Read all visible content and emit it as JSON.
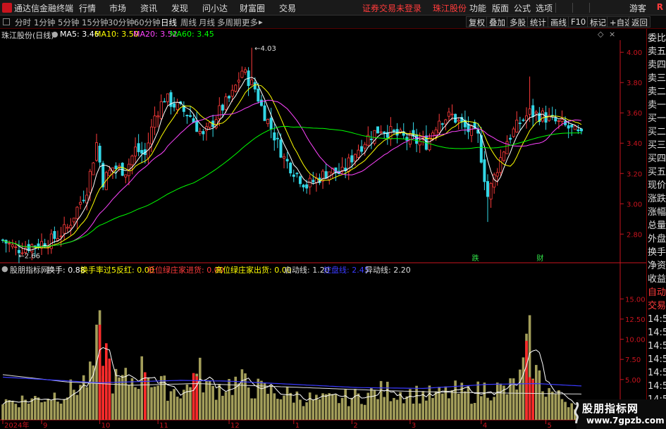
{
  "window": {
    "title": "通达信金融终端",
    "menu": [
      "行情",
      "市场",
      "资讯",
      "发现",
      "问小达",
      "财富圈",
      "交易"
    ],
    "notice": "证券交易未登录",
    "stock_name_top": "珠江股份",
    "menu_right": [
      "功能",
      "版面",
      "公式",
      "选项"
    ],
    "guest": "游客",
    "r_label": "R"
  },
  "toolbar": {
    "periods": [
      "分时",
      "1分钟",
      "5分钟",
      "15分钟",
      "30分钟",
      "60分钟",
      "日线",
      "周线",
      "月线",
      "多周期",
      "更多"
    ],
    "active_period": "日线",
    "more_arrow": "▸",
    "right_buttons": [
      "复权",
      "叠加",
      "多股",
      "统计",
      "画线",
      "F10",
      "标记",
      "+自选",
      "返回"
    ]
  },
  "ma_header": {
    "title": "珠江股份(日线)",
    "ma5_label": "MA5: 3.46",
    "ma10_label": "MA10: 3.50",
    "ma20_label": "MA20: 3.52",
    "ma60_label": "MA60: 3.45",
    "colors": {
      "ma5": "#ffffff",
      "ma10": "#ffff00",
      "ma20": "#ff44ff",
      "ma60": "#00ff00"
    }
  },
  "indicator_header": {
    "name": "股朋指标网",
    "huanshou": "换手: 0.88",
    "huanshou5": "换手率过5反红: 0.00",
    "low_in": "低位绿庄家进货: 0.00",
    "high_out": "高位绿庄家出货: 0.00",
    "qidong": "启动线: 1.20",
    "kongpan": "控盘线: 2.45",
    "yidong": "异动线: 2.20"
  },
  "right_panel": {
    "items": [
      "委比",
      "卖五",
      "卖四",
      "卖三",
      "卖二",
      "卖一",
      "买一",
      "买二",
      "买三",
      "买四",
      "买五",
      "现价",
      "涨跌",
      "涨幅",
      "总量",
      "外盘",
      "换手",
      "净资",
      "收益",
      "自动",
      "交易",
      "14:5",
      "14:5",
      "14:5",
      "14:5",
      "14:5",
      "14:5",
      "14:5",
      "14:5",
      "14:5"
    ]
  },
  "watermark": {
    "line1": "股朋指标网",
    "line2": "www.7gpzb.com"
  },
  "colors": {
    "up": "#ff3b3b",
    "down": "#33d7e6",
    "bg": "#000000",
    "axis": "#c8141e"
  },
  "chart_data": [
    {
      "type": "candlestick",
      "title": "珠江股份(日线)",
      "ylim": [
        2.62,
        4.08
      ],
      "yticks": [
        2.8,
        3.0,
        3.2,
        3.4,
        3.6,
        3.8,
        4.0
      ],
      "annotations": [
        {
          "label": "4.03",
          "index": 77,
          "value": 4.03
        },
        {
          "label": "2.66",
          "index": 4,
          "value": 2.66
        }
      ],
      "events": [
        {
          "label": "跌",
          "index": 146
        },
        {
          "label": "财",
          "index": 166
        }
      ],
      "x_ticks": [
        {
          "label": "2024年",
          "index": 0
        },
        {
          "label": "9",
          "index": 12
        },
        {
          "label": "10",
          "index": 30
        },
        {
          "label": "11",
          "index": 48
        },
        {
          "label": "12",
          "index": 70
        },
        {
          "label": "1",
          "index": 90
        },
        {
          "label": "2",
          "index": 108
        },
        {
          "label": "3",
          "index": 126
        },
        {
          "label": "4",
          "index": 148
        },
        {
          "label": "5",
          "index": 168
        }
      ],
      "anchors": [
        [
          0,
          2.76
        ],
        [
          4,
          2.7
        ],
        [
          10,
          2.73
        ],
        [
          15,
          2.76
        ],
        [
          20,
          2.84
        ],
        [
          26,
          3.1
        ],
        [
          29,
          3.4
        ],
        [
          31,
          3.15
        ],
        [
          34,
          3.24
        ],
        [
          38,
          3.22
        ],
        [
          41,
          3.36
        ],
        [
          44,
          3.32
        ],
        [
          47,
          3.58
        ],
        [
          50,
          3.7
        ],
        [
          54,
          3.64
        ],
        [
          58,
          3.58
        ],
        [
          62,
          3.44
        ],
        [
          67,
          3.61
        ],
        [
          71,
          3.72
        ],
        [
          74,
          3.88
        ],
        [
          78,
          3.76
        ],
        [
          80,
          3.64
        ],
        [
          83,
          3.5
        ],
        [
          87,
          3.3
        ],
        [
          90,
          3.22
        ],
        [
          94,
          3.12
        ],
        [
          97,
          3.16
        ],
        [
          101,
          3.22
        ],
        [
          105,
          3.2
        ],
        [
          109,
          3.34
        ],
        [
          113,
          3.44
        ],
        [
          117,
          3.5
        ],
        [
          121,
          3.46
        ],
        [
          126,
          3.42
        ],
        [
          131,
          3.4
        ],
        [
          135,
          3.56
        ],
        [
          139,
          3.58
        ],
        [
          143,
          3.5
        ],
        [
          147,
          3.44
        ],
        [
          150,
          3.05
        ],
        [
          153,
          3.24
        ],
        [
          156,
          3.42
        ],
        [
          160,
          3.54
        ],
        [
          163,
          3.6
        ],
        [
          167,
          3.58
        ],
        [
          171,
          3.54
        ],
        [
          175,
          3.5
        ],
        [
          179,
          3.44
        ]
      ]
    },
    {
      "type": "bar+line",
      "title": "股朋指标网",
      "ylim": [
        0,
        18.0
      ],
      "yticks": [
        5.0,
        7.5,
        10.0,
        12.5,
        15.0
      ],
      "huanshou_anchors": [
        [
          0,
          2.3
        ],
        [
          10,
          2.6
        ],
        [
          20,
          3.4
        ],
        [
          27,
          5.2
        ],
        [
          30,
          10.2
        ],
        [
          32,
          5.5
        ],
        [
          36,
          4.6
        ],
        [
          41,
          5.2
        ],
        [
          44,
          6.5
        ],
        [
          48,
          4.2
        ],
        [
          54,
          3.6
        ],
        [
          58,
          4.0
        ],
        [
          61,
          5.7
        ],
        [
          64,
          3.8
        ],
        [
          70,
          4.4
        ],
        [
          74,
          4.6
        ],
        [
          78,
          3.9
        ],
        [
          84,
          3.4
        ],
        [
          90,
          3.0
        ],
        [
          98,
          2.4
        ],
        [
          110,
          2.9
        ],
        [
          118,
          3.6
        ],
        [
          126,
          3.3
        ],
        [
          134,
          3.0
        ],
        [
          140,
          3.5
        ],
        [
          145,
          3.2
        ],
        [
          150,
          4.0
        ],
        [
          156,
          3.6
        ],
        [
          160,
          5.0
        ],
        [
          163,
          9.5
        ],
        [
          165,
          5.7
        ],
        [
          168,
          4.0
        ],
        [
          172,
          2.8
        ],
        [
          176,
          2.2
        ],
        [
          179,
          2.0
        ]
      ],
      "red_bars": [
        [
          30,
          11.8
        ],
        [
          31,
          6.7
        ],
        [
          32,
          9.5
        ],
        [
          33,
          7.6
        ],
        [
          44,
          5.9
        ],
        [
          59,
          5.8
        ],
        [
          60,
          5.4
        ],
        [
          162,
          9.8
        ],
        [
          163,
          5.3
        ],
        [
          164,
          5.0
        ]
      ],
      "qidong_anchors": [
        [
          0,
          5.6
        ],
        [
          20,
          4.7
        ],
        [
          40,
          4.3
        ],
        [
          60,
          4.5
        ],
        [
          80,
          4.2
        ],
        [
          100,
          3.9
        ],
        [
          120,
          3.6
        ],
        [
          140,
          3.4
        ],
        [
          160,
          3.3
        ],
        [
          179,
          3.2
        ]
      ],
      "kongpan_anchors": [
        [
          0,
          5.3
        ],
        [
          30,
          4.6
        ],
        [
          55,
          4.9
        ],
        [
          70,
          4.8
        ],
        [
          90,
          4.4
        ],
        [
          110,
          4.0
        ],
        [
          130,
          3.9
        ],
        [
          150,
          4.4
        ],
        [
          165,
          4.5
        ],
        [
          179,
          4.2
        ]
      ]
    }
  ]
}
